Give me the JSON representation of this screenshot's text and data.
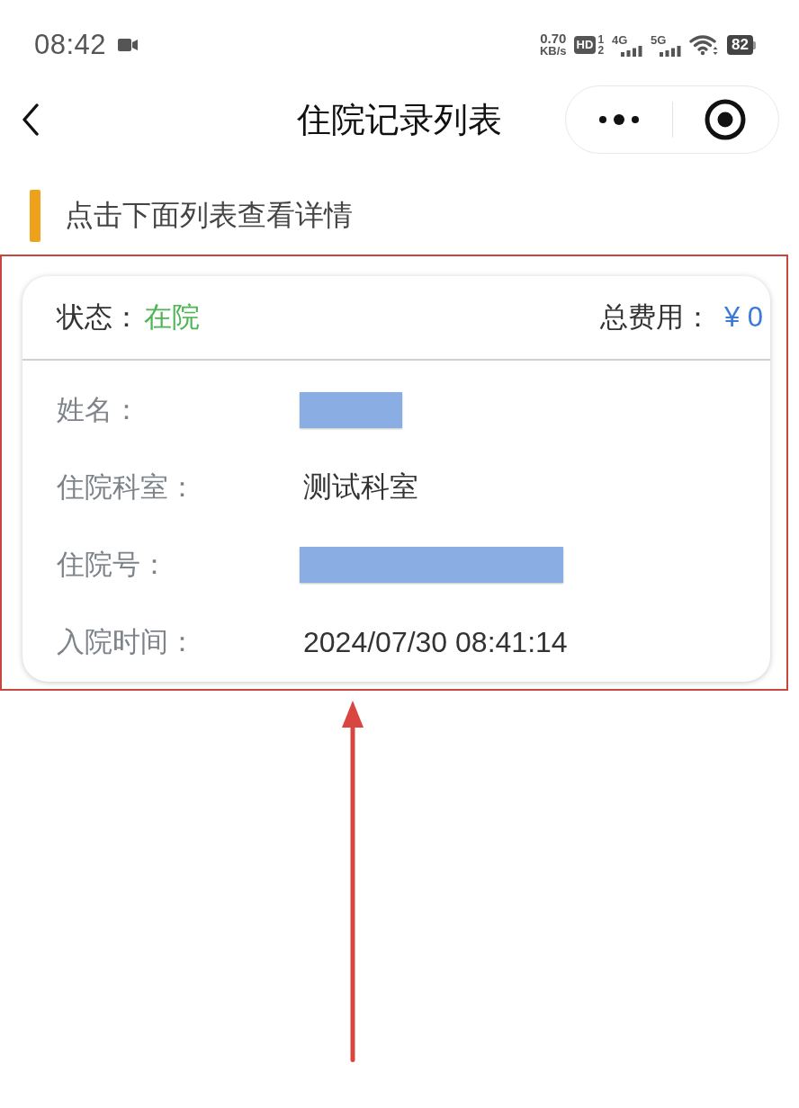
{
  "status_bar": {
    "time": "08:42",
    "net_speed": "0.70",
    "net_speed_unit": "KB/s",
    "hd_label": "HD",
    "sim_slots": [
      "1",
      "2"
    ],
    "networks": [
      "4G",
      "5G"
    ],
    "battery": "82"
  },
  "nav_bar": {
    "title": "住院记录列表"
  },
  "hint": "点击下面列表查看详情",
  "records": [
    {
      "status_label": "状态：",
      "status": "在院",
      "total_label": "总费用：",
      "total": "¥ 0",
      "fields": [
        {
          "label": "姓名：",
          "kind": "redacted"
        },
        {
          "label": "住院科室：",
          "kind": "text",
          "value": "测试科室"
        },
        {
          "label": "住院号：",
          "kind": "redacted"
        },
        {
          "label": "入院时间：",
          "kind": "text",
          "value": "2024/07/30 08:41:14"
        }
      ]
    }
  ]
}
